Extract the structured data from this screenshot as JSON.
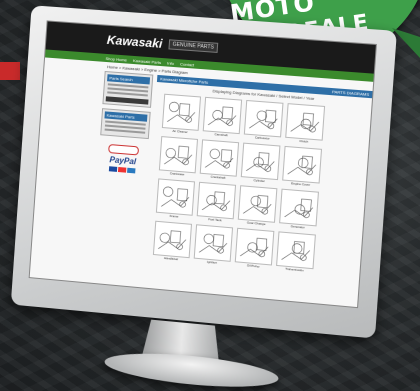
{
  "badge": {
    "line1": "MOTO",
    "line2": "DEALE"
  },
  "site": {
    "logo": "Kawasaki",
    "tag": "GENUINE PARTS",
    "nav": [
      "Shop Home",
      "Kawasaki Parts",
      "Info",
      "Contact"
    ],
    "breadcrumb": "Home > Kawasaki > Engine > Parts Diagram",
    "left_boxes": [
      {
        "title": "Parts Search"
      },
      {
        "title": "Kawasaki Parts"
      }
    ],
    "paypal": "PayPal",
    "main_title": "Kawasaki Microfiche Parts",
    "main_right": "PARTS DIAGRAMS",
    "main_note": "Displaying Diagrams for Kawasaki / Select Model / Year",
    "thumbnails": [
      "Air Cleaner",
      "Camshaft",
      "Carburetor",
      "Clutch",
      "Crankcase",
      "Crankshaft",
      "Cylinder",
      "Engine Cover",
      "Frame",
      "Fuel Tank",
      "Gear Change",
      "Generator",
      "Handlebar",
      "Ignition",
      "Oil Pump",
      "Transmission"
    ]
  },
  "colors": {
    "badge": "#3ea04a",
    "nav_green": "#3b8a2c",
    "header_blue": "#2e6fa7",
    "accent_red": "#c92a2a"
  }
}
